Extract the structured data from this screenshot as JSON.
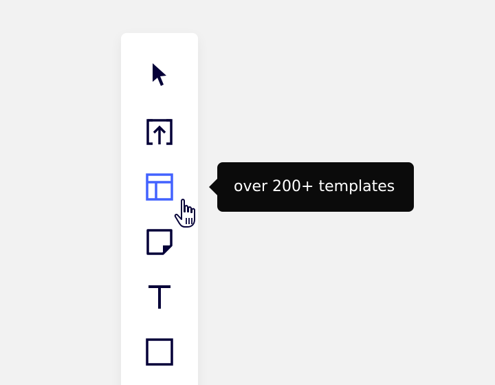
{
  "toolbar": {
    "tools": [
      {
        "name": "select",
        "icon": "arrow-pointer-icon",
        "active": false
      },
      {
        "name": "upload",
        "icon": "upload-icon",
        "active": false
      },
      {
        "name": "templates",
        "icon": "layout-template-icon",
        "active": true
      },
      {
        "name": "sticky-note",
        "icon": "sticky-note-icon",
        "active": false
      },
      {
        "name": "text",
        "icon": "text-icon",
        "active": false
      },
      {
        "name": "shape",
        "icon": "square-icon",
        "active": false
      }
    ]
  },
  "tooltip": {
    "text": "over 200+ templates"
  },
  "colors": {
    "background": "#f2f2f2",
    "toolbar": "#ffffff",
    "icon": "#050038",
    "active_icon": "#4262ff",
    "tooltip_bg": "#0b0b0b",
    "tooltip_text": "#ffffff"
  }
}
